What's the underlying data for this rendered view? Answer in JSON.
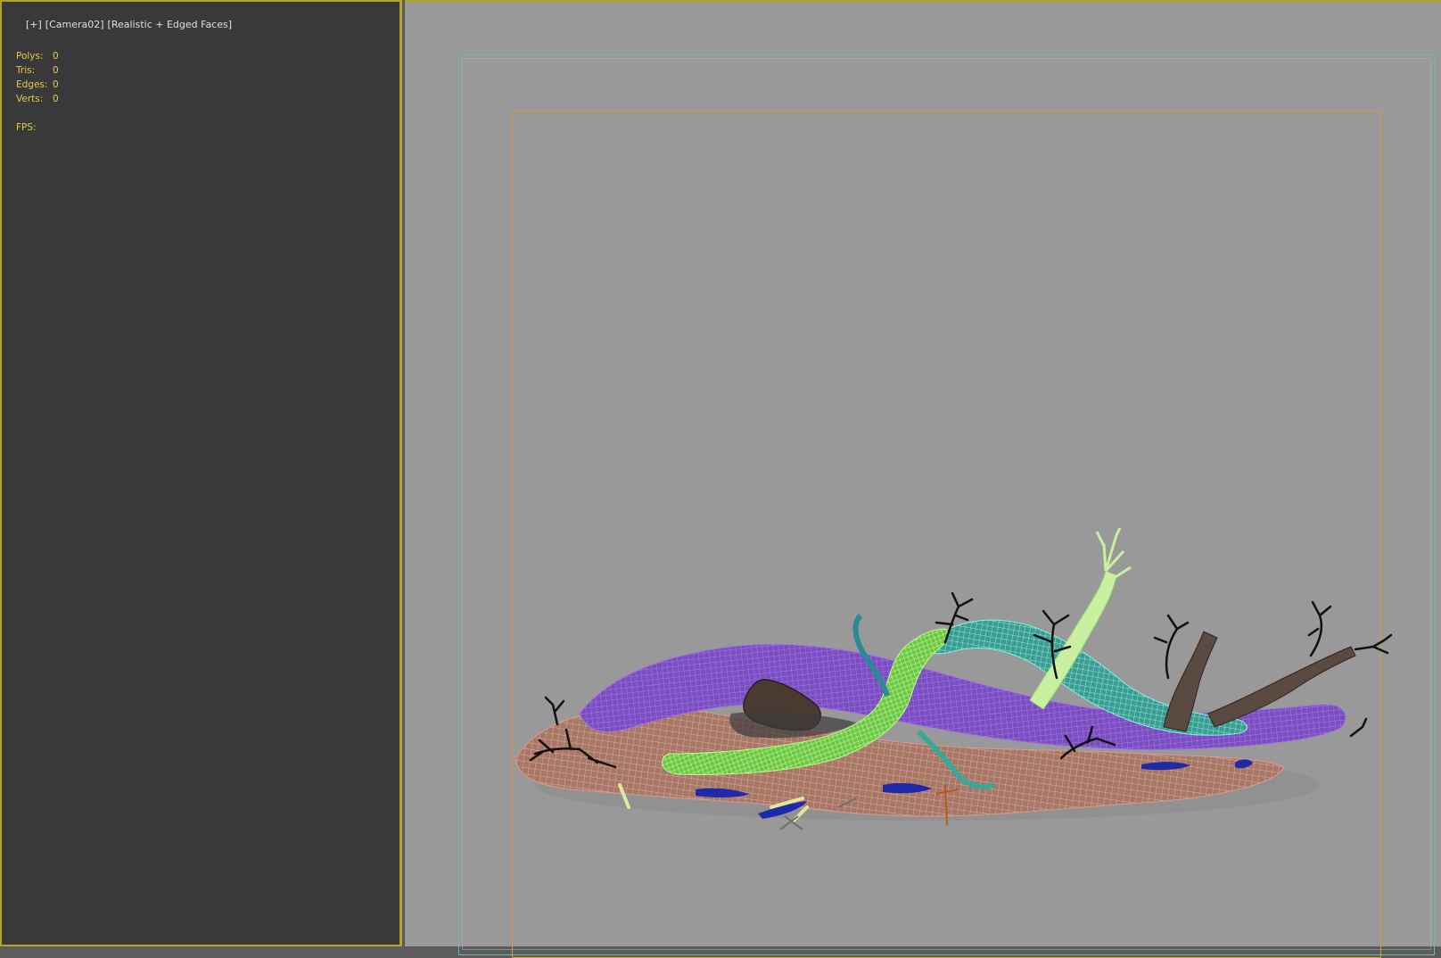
{
  "left_viewport": {
    "label_parts": [
      "[+]",
      "[Camera02]",
      "[Realistic + Edged Faces]"
    ]
  },
  "stats": {
    "polys_label": "Polys:",
    "polys_value": "0",
    "tris_label": "Tris:",
    "tris_value": "0",
    "edges_label": "Edges:",
    "edges_value": "0",
    "verts_label": "Verts:",
    "verts_value": "0",
    "fps_label": "FPS:"
  },
  "colors": {
    "active_border": "#b5a22a",
    "stats_text": "#e6c84a",
    "label_text": "#e0e0e0",
    "dark_viewport_bg": "#393939",
    "camera_viewport_bg": "#999999",
    "safe_frame_cyan": "#6fb7b7",
    "safe_frame_orange": "#c8a23c"
  },
  "scene": {
    "description_icon": "wireframe-scene"
  }
}
